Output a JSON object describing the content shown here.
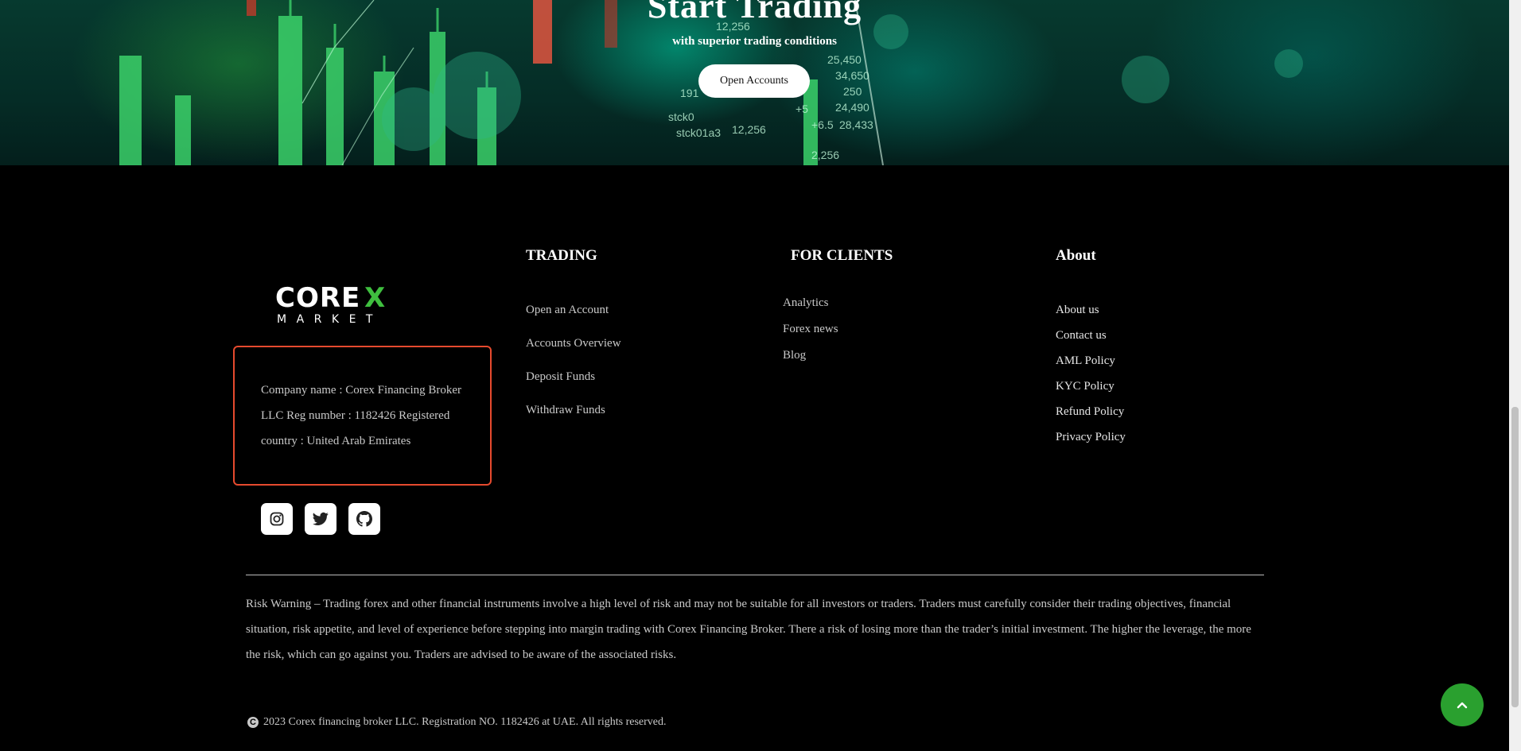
{
  "hero": {
    "title": "Start Trading",
    "subtitle": "with superior trading conditions",
    "button_label": "Open Accounts",
    "ticker_values": [
      "12,256",
      "25,450",
      "34,650",
      "250",
      "24,490",
      "28,433",
      "2,256",
      "12,256",
      "stck01a3",
      "191",
      "stck0",
      "+6.5",
      "+5"
    ]
  },
  "brand": {
    "logo_line1": "COREX",
    "logo_line2": "MARKET",
    "accent": "#3fbf3f"
  },
  "company": {
    "text": "Company name : Corex Financing Broker LLC Reg number : 1182426 Registered country : United Arab Emirates"
  },
  "social": [
    "instagram-icon",
    "twitter-icon",
    "github-icon"
  ],
  "columns": {
    "trading": {
      "title": "TRADING",
      "links": [
        "Open an Account",
        "Accounts Overview",
        "Deposit Funds",
        "Withdraw Funds"
      ]
    },
    "clients": {
      "title": "FOR CLIENTS",
      "links": [
        "Analytics",
        "Forex news",
        "Blog"
      ]
    },
    "about": {
      "title": "About",
      "links": [
        "About us",
        "Contact us",
        "AML Policy",
        "KYC Policy",
        "Refund Policy",
        "Privacy Policy"
      ]
    }
  },
  "risk_warning": "Risk Warning – Trading forex and other financial instruments involve a high level of risk and may not be suitable for all investors or traders. Traders must carefully consider their trading objectives, financial situation, risk appetite, and level of experience before stepping into margin trading with Corex Financing Broker. There a risk of losing more than the trader’s initial investment. The higher the leverage, the more the risk, which can go against you. Traders are advised to be aware of the associated risks.",
  "copyright": {
    "symbol": "C",
    "text": "2023 Corex financing broker LLC. Registration NO. 1182426 at UAE. All rights reserved."
  },
  "colors": {
    "background": "#000000",
    "company_border": "#e64a2e",
    "scroll_top": "#2aa02f"
  }
}
